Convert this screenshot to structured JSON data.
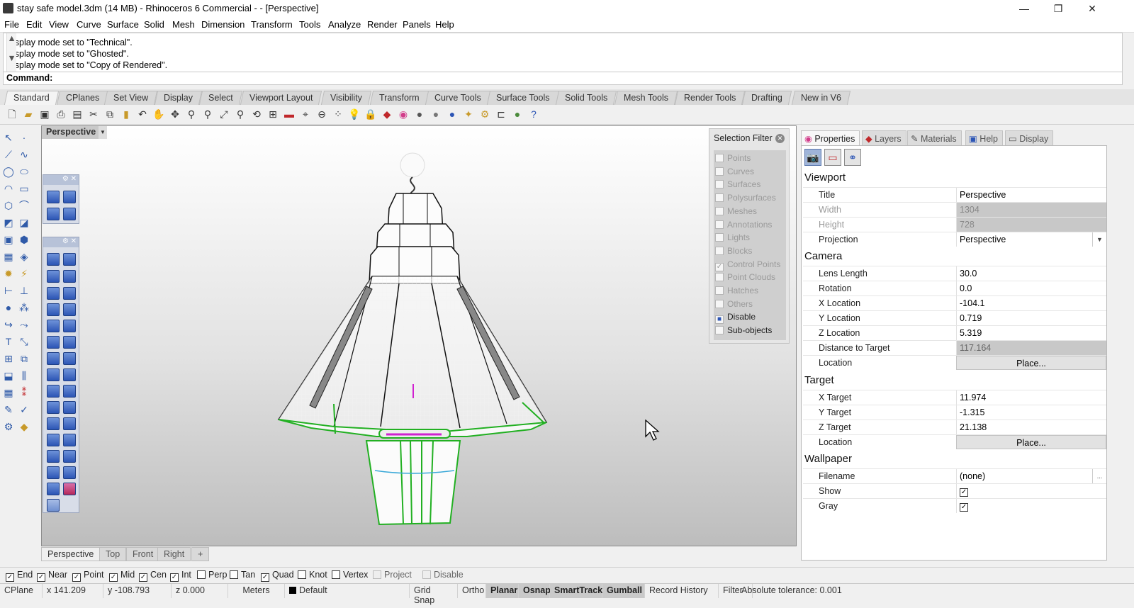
{
  "window": {
    "title": "stay safe model.3dm (14 MB) - Rhinoceros 6 Commercial - - [Perspective]",
    "controls": [
      "—",
      "❐",
      "✕"
    ]
  },
  "menu": [
    "File",
    "Edit",
    "View",
    "Curve",
    "Surface",
    "Solid",
    "Mesh",
    "Dimension",
    "Transform",
    "Tools",
    "Analyze",
    "Render",
    "Panels",
    "Help"
  ],
  "command": {
    "history": [
      "Display mode set to \"Technical\".",
      "Display mode set to \"Ghosted\".",
      "Display mode set to \"Copy of Rendered\"."
    ],
    "prompt": "Command:"
  },
  "toolbar_tabs": [
    "Standard",
    "CPlanes",
    "Set View",
    "Display",
    "Select",
    "Viewport Layout",
    "Visibility",
    "Transform",
    "Curve Tools",
    "Surface Tools",
    "Solid Tools",
    "Mesh Tools",
    "Render Tools",
    "Drafting",
    "New in V6"
  ],
  "viewport": {
    "title": "Perspective"
  },
  "selection_filter": {
    "title": "Selection Filter",
    "items": [
      {
        "label": "Points",
        "checked": false,
        "enabled": false
      },
      {
        "label": "Curves",
        "checked": false,
        "enabled": false
      },
      {
        "label": "Surfaces",
        "checked": false,
        "enabled": false
      },
      {
        "label": "Polysurfaces",
        "checked": false,
        "enabled": false
      },
      {
        "label": "Meshes",
        "checked": false,
        "enabled": false
      },
      {
        "label": "Annotations",
        "checked": false,
        "enabled": false
      },
      {
        "label": "Lights",
        "checked": false,
        "enabled": false
      },
      {
        "label": "Blocks",
        "checked": false,
        "enabled": false
      },
      {
        "label": "Control Points",
        "checked": true,
        "enabled": false
      },
      {
        "label": "Point Clouds",
        "checked": false,
        "enabled": false
      },
      {
        "label": "Hatches",
        "checked": false,
        "enabled": false
      },
      {
        "label": "Others",
        "checked": false,
        "enabled": false
      },
      {
        "label": "Disable",
        "checked": true,
        "enabled": true
      },
      {
        "label": "Sub-objects",
        "checked": false,
        "enabled": true
      }
    ]
  },
  "panel_tabs": [
    "Properties",
    "Layers",
    "Materials",
    "Help",
    "Display"
  ],
  "properties": {
    "viewport_section": "Viewport",
    "title_label": "Title",
    "title_value": "Perspective",
    "width_label": "Width",
    "width_value": "1304",
    "height_label": "Height",
    "height_value": "728",
    "projection_label": "Projection",
    "projection_value": "Perspective",
    "camera_section": "Camera",
    "lens_label": "Lens Length",
    "lens_value": "30.0",
    "rotation_label": "Rotation",
    "rotation_value": "0.0",
    "xloc_label": "X Location",
    "xloc_value": "-104.1",
    "yloc_label": "Y Location",
    "yloc_value": "0.719",
    "zloc_label": "Z Location",
    "zloc_value": "5.319",
    "dist_label": "Distance to Target",
    "dist_value": "117.164",
    "camloc_label": "Location",
    "camloc_button": "Place...",
    "target_section": "Target",
    "xt_label": "X Target",
    "xt_value": "11.974",
    "yt_label": "Y Target",
    "yt_value": "-1.315",
    "zt_label": "Z Target",
    "zt_value": "21.138",
    "tloc_label": "Location",
    "tloc_button": "Place...",
    "wallpaper_section": "Wallpaper",
    "file_label": "Filename",
    "file_value": "(none)",
    "file_button": "...",
    "show_label": "Show",
    "gray_label": "Gray"
  },
  "viewport_tabs": [
    "Perspective",
    "Top",
    "Front",
    "Right",
    "+"
  ],
  "osnap": [
    {
      "label": "End",
      "checked": true,
      "enabled": true
    },
    {
      "label": "Near",
      "checked": true,
      "enabled": true
    },
    {
      "label": "Point",
      "checked": true,
      "enabled": true
    },
    {
      "label": "Mid",
      "checked": true,
      "enabled": true
    },
    {
      "label": "Cen",
      "checked": true,
      "enabled": true
    },
    {
      "label": "Int",
      "checked": true,
      "enabled": true
    },
    {
      "label": "Perp",
      "checked": false,
      "enabled": true
    },
    {
      "label": "Tan",
      "checked": false,
      "enabled": true
    },
    {
      "label": "Quad",
      "checked": true,
      "enabled": true
    },
    {
      "label": "Knot",
      "checked": false,
      "enabled": true
    },
    {
      "label": "Vertex",
      "checked": false,
      "enabled": true
    },
    {
      "label": "Project",
      "checked": false,
      "enabled": false
    },
    {
      "label": "Disable",
      "checked": false,
      "enabled": false
    }
  ],
  "status": {
    "cplane": "CPlane",
    "x": "x 141.209",
    "y": "y -108.793",
    "z": "z 0.000",
    "units": "Meters",
    "layer": "Default",
    "grid_snap": "Grid Snap",
    "ortho": "Ortho",
    "planar": "Planar",
    "osnap": "Osnap",
    "smarttrack": "SmartTrack",
    "gumball": "Gumball",
    "record_history": "Record History",
    "filter": "Filter",
    "tolerance": "Absolute tolerance: 0.001"
  },
  "colors": {
    "accent_selection": "#22b022",
    "tab_active": "#f4f4f4",
    "magenta": "#d020d0",
    "cyan": "#3aa8d8"
  }
}
